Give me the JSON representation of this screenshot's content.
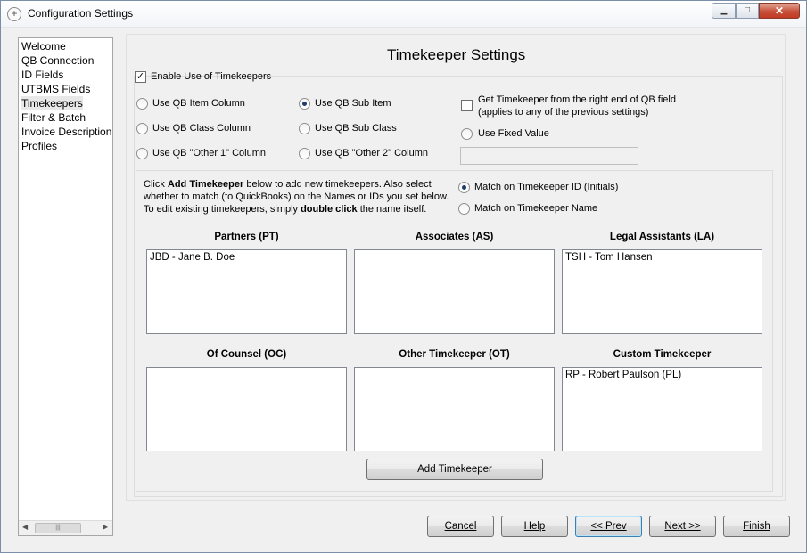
{
  "window": {
    "title": "Configuration Settings",
    "controls": {
      "minimize": "▁",
      "maximize": "□",
      "close": "✕"
    }
  },
  "nav": {
    "items": [
      {
        "label": "Welcome"
      },
      {
        "label": "QB Connection"
      },
      {
        "label": "ID Fields"
      },
      {
        "label": "UTBMS Fields"
      },
      {
        "label": "Timekeepers"
      },
      {
        "label": "Filter & Batch"
      },
      {
        "label": "Invoice Description"
      },
      {
        "label": "Profiles"
      }
    ],
    "selected": "Timekeepers",
    "scroll_left": "◀",
    "scroll_right": "▶",
    "scroll_thumb": "|||"
  },
  "page": {
    "title": "Timekeeper Settings",
    "enable_label": "Enable Use of Timekeepers",
    "enable_checked": true,
    "source_options": [
      {
        "label": "Use QB Item Column",
        "selected": false
      },
      {
        "label": "Use QB Sub Item",
        "selected": true
      },
      {
        "label": "Use QB Class Column",
        "selected": false
      },
      {
        "label": "Use QB Sub Class",
        "selected": false
      },
      {
        "label": "Use QB \"Other 1\" Column",
        "selected": false
      },
      {
        "label": "Use QB \"Other 2\" Column",
        "selected": false
      }
    ],
    "right_end": {
      "line1": "Get Timekeeper from the right end of QB field",
      "line2": "(applies to any of the previous settings)",
      "checked": false
    },
    "fixed_value": {
      "label": "Use Fixed Value",
      "selected": false,
      "value": ""
    },
    "instructions": {
      "line1_a": "Click ",
      "line1_b": "Add Timekeeper",
      "line1_c": " below to add new timekeepers. Also select",
      "line2": "whether to match (to QuickBooks) on the Names or IDs you set below.",
      "line3_a": "To edit existing timekeepers, simply ",
      "line3_b": "double click",
      "line3_c": " the name itself."
    },
    "match_options": [
      {
        "label": "Match on Timekeeper ID (Initials)",
        "selected": true
      },
      {
        "label": "Match on Timekeeper Name",
        "selected": false
      }
    ],
    "lists": [
      {
        "title": "Partners (PT)",
        "items": [
          "JBD - Jane B. Doe"
        ]
      },
      {
        "title": "Associates (AS)",
        "items": []
      },
      {
        "title": "Legal Assistants (LA)",
        "items": [
          "TSH - Tom Hansen"
        ]
      },
      {
        "title": "Of Counsel (OC)",
        "items": []
      },
      {
        "title": "Other Timekeeper (OT)",
        "items": []
      },
      {
        "title": "Custom Timekeeper",
        "items": [
          "RP - Robert Paulson (PL)"
        ]
      }
    ],
    "add_button": "Add Timekeeper"
  },
  "footer": {
    "cancel": "Cancel",
    "help": "Help",
    "prev": "<< Prev",
    "next": "Next >>",
    "finish": "Finish"
  }
}
